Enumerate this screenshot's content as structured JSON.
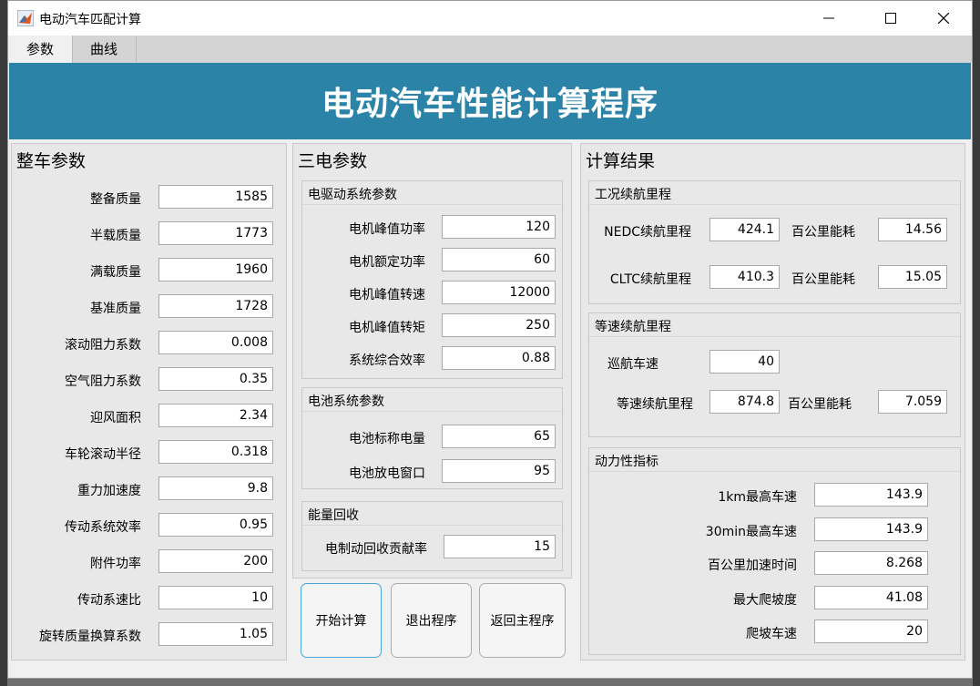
{
  "window": {
    "title": "电动汽车匹配计算",
    "minimize_icon": "minimize-icon",
    "maximize_icon": "maximize-icon",
    "close_icon": "close-icon"
  },
  "menu": {
    "tabs": [
      "参数",
      "曲线"
    ]
  },
  "banner": {
    "title": "电动汽车性能计算程序",
    "color": "#2b83a8"
  },
  "vehicle": {
    "title": "整车参数",
    "fields": [
      {
        "label": "整备质量",
        "value": "1585"
      },
      {
        "label": "半载质量",
        "value": "1773"
      },
      {
        "label": "满载质量",
        "value": "1960"
      },
      {
        "label": "基准质量",
        "value": "1728"
      },
      {
        "label": "滚动阻力系数",
        "value": "0.008"
      },
      {
        "label": "空气阻力系数",
        "value": "0.35"
      },
      {
        "label": "迎风面积",
        "value": "2.34"
      },
      {
        "label": "车轮滚动半径",
        "value": "0.318"
      },
      {
        "label": "重力加速度",
        "value": "9.8"
      },
      {
        "label": "传动系统效率",
        "value": "0.95"
      },
      {
        "label": "附件功率",
        "value": "200"
      },
      {
        "label": "传动系速比",
        "value": "10"
      },
      {
        "label": "旋转质量换算系数",
        "value": "1.05"
      }
    ]
  },
  "threeelec": {
    "title": "三电参数",
    "motor": {
      "title": "电驱动系统参数",
      "fields": [
        {
          "label": "电机峰值功率",
          "value": "120"
        },
        {
          "label": "电机额定功率",
          "value": "60"
        },
        {
          "label": "电机峰值转速",
          "value": "12000"
        },
        {
          "label": "电机峰值转矩",
          "value": "250"
        },
        {
          "label": "系统综合效率",
          "value": "0.88"
        }
      ]
    },
    "battery": {
      "title": "电池系统参数",
      "fields": [
        {
          "label": "电池标称电量",
          "value": "65"
        },
        {
          "label": "电池放电窗口",
          "value": "95"
        }
      ]
    },
    "regen": {
      "title": "能量回收",
      "fields": [
        {
          "label": "电制动回收贡献率",
          "value": "15"
        }
      ]
    }
  },
  "buttons": {
    "start": "开始计算",
    "exit": "退出程序",
    "back": "返回主程序"
  },
  "results": {
    "title": "计算结果",
    "cycle": {
      "title": "工况续航里程",
      "rows": [
        {
          "label": "NEDC续航里程",
          "value": "424.1",
          "energy_label": "百公里能耗",
          "energy_value": "14.56"
        },
        {
          "label": "CLTC续航里程",
          "value": "410.3",
          "energy_label": "百公里能耗",
          "energy_value": "15.05"
        }
      ]
    },
    "constant": {
      "title": "等速续航里程",
      "speed_label": "巡航车速",
      "speed_value": "40",
      "range_label": "等速续航里程",
      "range_value": "874.8",
      "energy_label": "百公里能耗",
      "energy_value": "7.059"
    },
    "dynamics": {
      "title": "动力性指标",
      "fields": [
        {
          "label": "1km最高车速",
          "value": "143.9"
        },
        {
          "label": "30min最高车速",
          "value": "143.9"
        },
        {
          "label": "百公里加速时间",
          "value": "8.268"
        },
        {
          "label": "最大爬坡度",
          "value": "41.08"
        },
        {
          "label": "爬坡车速",
          "value": "20"
        }
      ]
    }
  }
}
